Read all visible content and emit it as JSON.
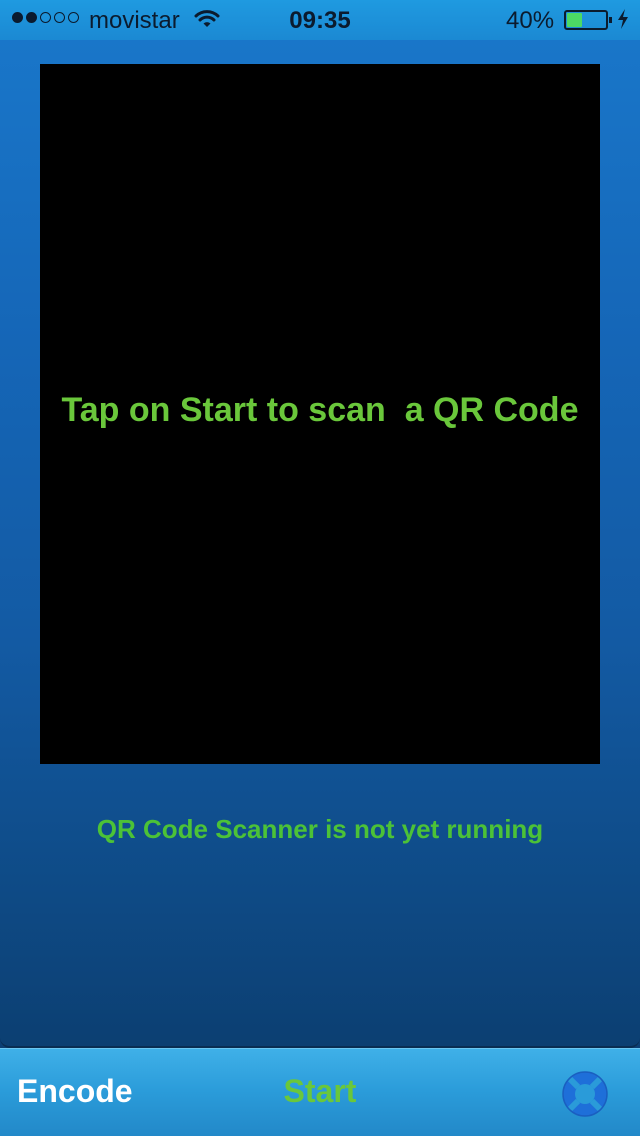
{
  "status_bar": {
    "carrier": "movistar",
    "time": "09:35",
    "battery_percent": "40%",
    "battery_level": 0.4,
    "signal_bars_filled": 2,
    "signal_bars_total": 5,
    "icons": [
      "signal-dots-icon",
      "wifi-icon",
      "battery-icon",
      "charging-bolt-icon"
    ]
  },
  "scanner": {
    "prompt": "Tap on Start to scan  a QR Code",
    "status": "QR Code Scanner is not yet running"
  },
  "toolbar": {
    "encode_label": "Encode",
    "start_label": "Start",
    "help_icon": "lifebuoy-icon"
  },
  "colors": {
    "accent_green": "#6ac73b",
    "status_green": "#4cc237",
    "toolbar_blue": "#2a9bd9",
    "panel_blue": "#135aa3"
  }
}
